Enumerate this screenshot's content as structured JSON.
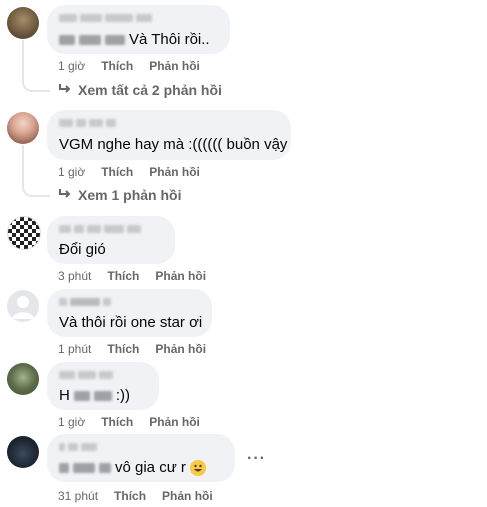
{
  "comments": [
    {
      "text_visible": "Và Thôi rồi..",
      "time": "1 giờ",
      "like": "Thích",
      "reply": "Phản hồi",
      "replies_label": "Xem tất cả 2 phản hồi"
    },
    {
      "text_visible": "VGM nghe hay mà :(((((( buồn vậy",
      "time": "1 giờ",
      "like": "Thích",
      "reply": "Phản hồi",
      "replies_label": "Xem 1 phản hồi"
    },
    {
      "text_visible": "Đổi gió",
      "time": "3 phút",
      "like": "Thích",
      "reply": "Phản hồi"
    },
    {
      "text_visible": "Và thôi rồi one star ơi",
      "time": "1 phút",
      "like": "Thích",
      "reply": "Phản hồi"
    },
    {
      "text_visible": ":))",
      "text_prefix": "H",
      "time": "1 giờ",
      "like": "Thích",
      "reply": "Phản hồi"
    },
    {
      "text_visible": "vô gia cư r",
      "time": "31 phút",
      "like": "Thích",
      "reply": "Phản hồi",
      "more": "···"
    }
  ],
  "icons": {
    "reply_arrow": "reply-arrow-icon",
    "emoji": "grinning-face-emoji",
    "more": "more-options-icon"
  }
}
